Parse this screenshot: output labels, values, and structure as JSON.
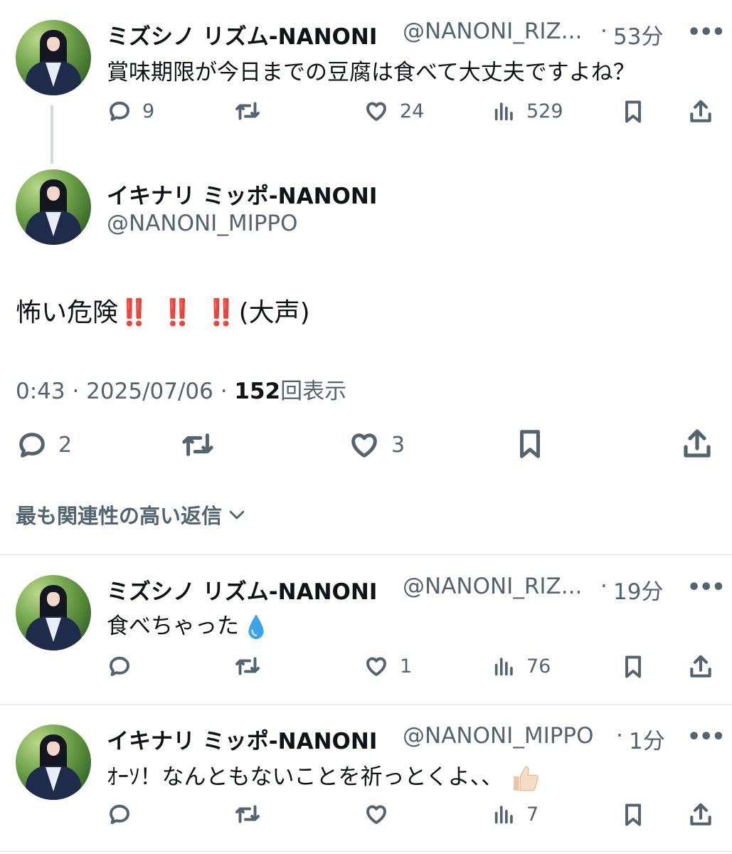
{
  "parent_tweet": {
    "name": "ミズシノ リズム-NANONI",
    "handle": "@NANONI_RIZ...",
    "separator": "·",
    "time": "53分",
    "text": "賞味期限が今日までの豆腐は食べて大丈夫ですよね？",
    "replies": "9",
    "likes": "24",
    "views": "529"
  },
  "main_tweet": {
    "name": "イキナリ ミッポ-NANONI",
    "handle": "@NANONI_MIPPO",
    "text_before": "怖い危険",
    "emphasis": "‼️ ‼️ ‼️",
    "text_after": "(大声)",
    "timestamp": "0:43 · 2025/07/06 · ",
    "views_count": "152",
    "views_label": "回表示",
    "replies": "2",
    "likes": "3"
  },
  "sort_label": "最も関連性の高い返信",
  "replies": [
    {
      "name": "ミズシノ リズム-NANONI",
      "handle": "@NANONI_RIZ...",
      "separator": "·",
      "time": "19分",
      "text": "食べちゃった",
      "emoji": "droplet",
      "replies": "",
      "likes": "1",
      "views": "76"
    },
    {
      "name": "イキナリ ミッポ-NANONI",
      "handle": "@NANONI_MIPPO",
      "separator": "·",
      "time": "1分",
      "text": "ｵｰｿ！なんともないことを祈っとくよ、、",
      "emoji": "thumbs-up",
      "replies": "",
      "likes": "",
      "views": "7"
    }
  ],
  "more_glyph": "•••",
  "icons": [
    "reply-icon",
    "retweet-icon",
    "like-icon",
    "views-icon",
    "bookmark-icon",
    "share-icon",
    "chevron-down-icon"
  ],
  "colors": {
    "text": "#0f1419",
    "secondary": "#536471",
    "emphasis": "#e0151c",
    "thread_line": "#cfd9de"
  }
}
